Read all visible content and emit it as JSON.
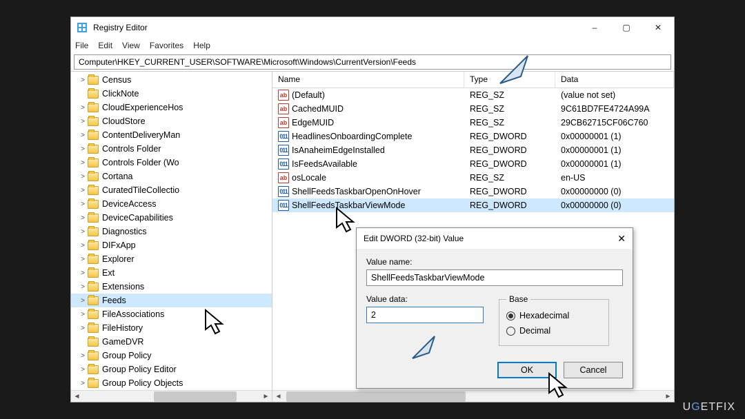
{
  "window": {
    "title": "Registry Editor",
    "minimize": "–",
    "maximize": "▢",
    "close": "✕"
  },
  "menu": [
    "File",
    "Edit",
    "View",
    "Favorites",
    "Help"
  ],
  "address": "Computer\\HKEY_CURRENT_USER\\SOFTWARE\\Microsoft\\Windows\\CurrentVersion\\Feeds",
  "tree": [
    {
      "label": "Census",
      "exp": ">"
    },
    {
      "label": "ClickNote",
      "exp": ""
    },
    {
      "label": "CloudExperienceHos",
      "exp": ">"
    },
    {
      "label": "CloudStore",
      "exp": ">"
    },
    {
      "label": "ContentDeliveryMan",
      "exp": ">"
    },
    {
      "label": "Controls Folder",
      "exp": ">"
    },
    {
      "label": "Controls Folder (Wo",
      "exp": ">"
    },
    {
      "label": "Cortana",
      "exp": ">"
    },
    {
      "label": "CuratedTileCollectio",
      "exp": ">"
    },
    {
      "label": "DeviceAccess",
      "exp": ">"
    },
    {
      "label": "DeviceCapabilities",
      "exp": ">"
    },
    {
      "label": "Diagnostics",
      "exp": ">"
    },
    {
      "label": "DIFxApp",
      "exp": ">"
    },
    {
      "label": "Explorer",
      "exp": ">"
    },
    {
      "label": "Ext",
      "exp": ">"
    },
    {
      "label": "Extensions",
      "exp": ">"
    },
    {
      "label": "Feeds",
      "exp": ">",
      "selected": true
    },
    {
      "label": "FileAssociations",
      "exp": ">"
    },
    {
      "label": "FileHistory",
      "exp": ">"
    },
    {
      "label": "GameDVR",
      "exp": ""
    },
    {
      "label": "Group Policy",
      "exp": ">"
    },
    {
      "label": "Group Policy Editor",
      "exp": ">"
    },
    {
      "label": "Group Policy Objects",
      "exp": ">"
    }
  ],
  "columns": {
    "name": "Name",
    "type": "Type",
    "data": "Data"
  },
  "values": [
    {
      "icon": "sz",
      "name": "(Default)",
      "type": "REG_SZ",
      "data": "(value not set)"
    },
    {
      "icon": "sz",
      "name": "CachedMUID",
      "type": "REG_SZ",
      "data": "9C61BD7FE4724A99A"
    },
    {
      "icon": "sz",
      "name": "EdgeMUID",
      "type": "REG_SZ",
      "data": "29CB62715CF06C760"
    },
    {
      "icon": "dw",
      "name": "HeadlinesOnboardingComplete",
      "type": "REG_DWORD",
      "data": "0x00000001 (1)"
    },
    {
      "icon": "dw",
      "name": "IsAnaheimEdgeInstalled",
      "type": "REG_DWORD",
      "data": "0x00000001 (1)"
    },
    {
      "icon": "dw",
      "name": "IsFeedsAvailable",
      "type": "REG_DWORD",
      "data": "0x00000001 (1)"
    },
    {
      "icon": "sz",
      "name": "osLocale",
      "type": "REG_SZ",
      "data": "en-US"
    },
    {
      "icon": "dw",
      "name": "ShellFeedsTaskbarOpenOnHover",
      "type": "REG_DWORD",
      "data": "0x00000000 (0)"
    },
    {
      "icon": "dw",
      "name": "ShellFeedsTaskbarViewMode",
      "type": "REG_DWORD",
      "data": "0x00000000 (0)",
      "selected": true
    }
  ],
  "dialog": {
    "title": "Edit DWORD (32-bit) Value",
    "value_name_label": "Value name:",
    "value_name": "ShellFeedsTaskbarViewMode",
    "value_data_label": "Value data:",
    "value_data": "2",
    "base_label": "Base",
    "hex": "Hexadecimal",
    "dec": "Decimal",
    "ok": "OK",
    "cancel": "Cancel"
  },
  "watermark": {
    "pre": "U",
    "g": "G",
    "post": "ETFIX"
  }
}
